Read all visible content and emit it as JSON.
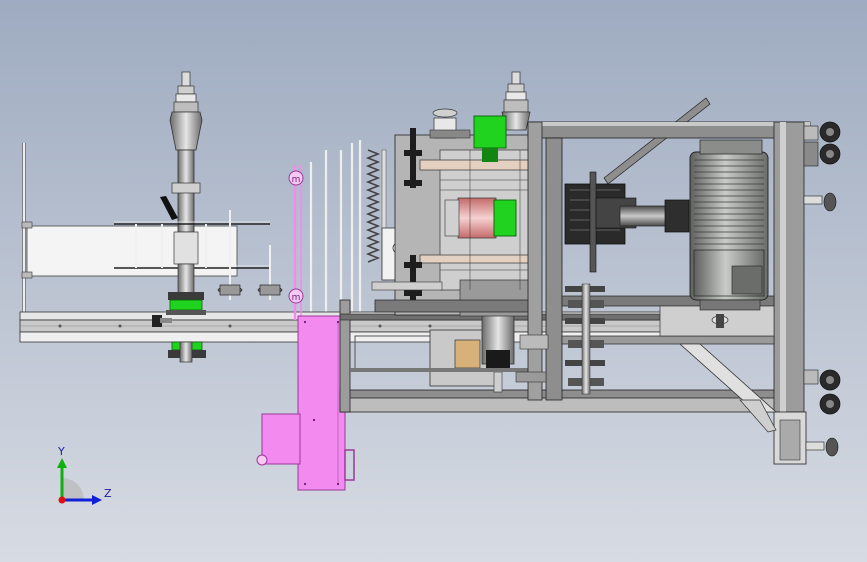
{
  "colors": {
    "background_top": "#9eabc0",
    "background_bottom": "#d7dbe3",
    "frame_gray": "#8e8e8e",
    "frame_dark": "#3c3c3c",
    "frame_light": "#d9d9d9",
    "guard_pink": "#f28af0",
    "guard_pink_dark": "#9a3b98",
    "part_green": "#1fd31f",
    "roller_red": "#e8a0a0",
    "motor_gray": "#a3a6a3",
    "axis_x": "#e01010",
    "axis_y": "#10b010",
    "axis_z": "#1020d8"
  },
  "triad": {
    "y_label": "Y",
    "z_label": "Z"
  },
  "icons": {
    "coordinate_triad": "xyz-triad-icon",
    "caster_wheel": "caster-wheel-icon",
    "handwheel": "handwheel-icon"
  }
}
